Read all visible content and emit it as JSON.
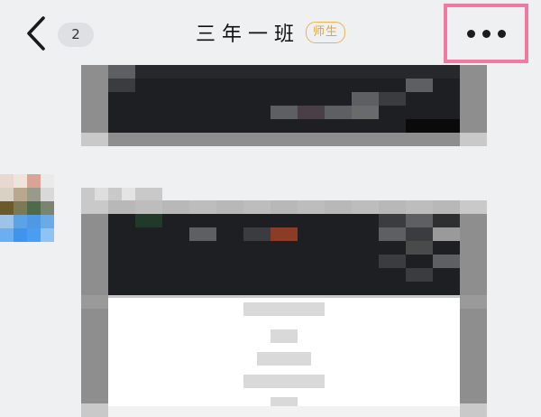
{
  "header": {
    "unread_count": "2",
    "title": "三年一班",
    "role_tag": "师生"
  },
  "icons": {
    "back": "chevron-left-icon",
    "more": "more-horizontal-icon"
  },
  "colors": {
    "background": "#eff0f2",
    "badge_bg": "#dfe0e3",
    "role_tag": "#e0a43a",
    "highlight_box": "#f07aa0"
  }
}
